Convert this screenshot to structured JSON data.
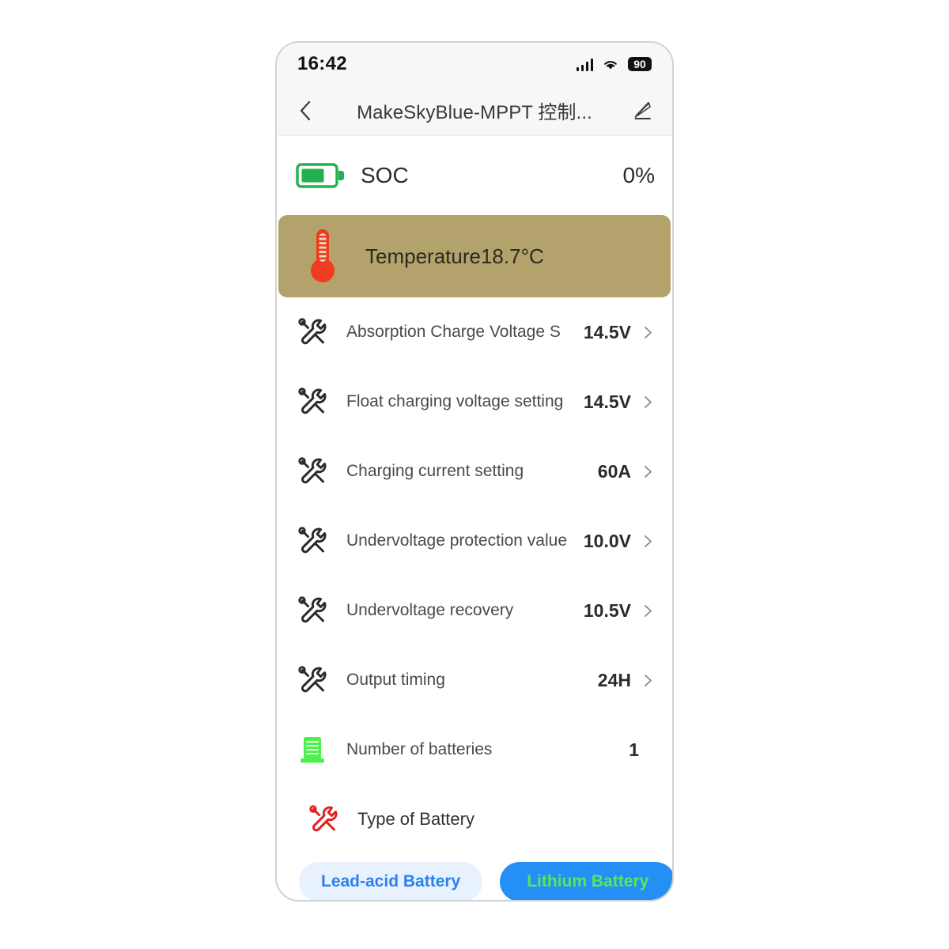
{
  "statusbar": {
    "time": "16:42",
    "signal_icon": "signal-bars-icon",
    "wifi_icon": "wifi-icon",
    "battery_level": "90"
  },
  "header": {
    "back_icon": "back-chevron-icon",
    "title": "MakeSkyBlue-MPPT 控制...",
    "edit_icon": "pencil-edit-icon"
  },
  "soc": {
    "icon": "battery-icon",
    "label": "SOC",
    "value": "0%"
  },
  "temperature": {
    "icon": "thermometer-icon",
    "label": "Temperature",
    "value": "18.7°C",
    "background_color": "#b4a26d"
  },
  "settings": [
    {
      "icon": "tools-icon",
      "label": "Absorption Charge Voltage S",
      "value": "14.5V",
      "chevron": "chevron-right-icon"
    },
    {
      "icon": "tools-icon",
      "label": "Float charging voltage setting",
      "value": "14.5V",
      "chevron": "chevron-right-icon"
    },
    {
      "icon": "tools-icon",
      "label": "Charging current setting",
      "value": "60A",
      "chevron": "chevron-right-icon"
    },
    {
      "icon": "tools-icon",
      "label": "Undervoltage protection value",
      "value": "10.0V",
      "chevron": "chevron-right-icon"
    },
    {
      "icon": "tools-icon",
      "label": "Undervoltage recovery",
      "value": "10.5V",
      "chevron": "chevron-right-icon"
    },
    {
      "icon": "tools-icon",
      "label": "Output timing",
      "value": "24H",
      "chevron": "chevron-right-icon"
    }
  ],
  "battery_count": {
    "icon": "battery-stack-icon",
    "label": "Number of batteries",
    "value": "1"
  },
  "battery_type": {
    "icon": "tools-icon-red",
    "label": "Type of Battery",
    "options": [
      {
        "label": "Lead-acid Battery",
        "selected": false
      },
      {
        "label": "Lithium Battery",
        "selected": true
      }
    ]
  },
  "colors": {
    "accent_blue": "#2490f5",
    "lead_bg": "#e8f2fe",
    "lead_text": "#2d7ff0",
    "lithium_text": "#5ae65a",
    "battery_green": "#22b14c",
    "stack_green": "#4df04d",
    "thermometer_red": "#f03b20",
    "tools_red": "#e02020",
    "temp_row_bg": "#b4a26d"
  }
}
